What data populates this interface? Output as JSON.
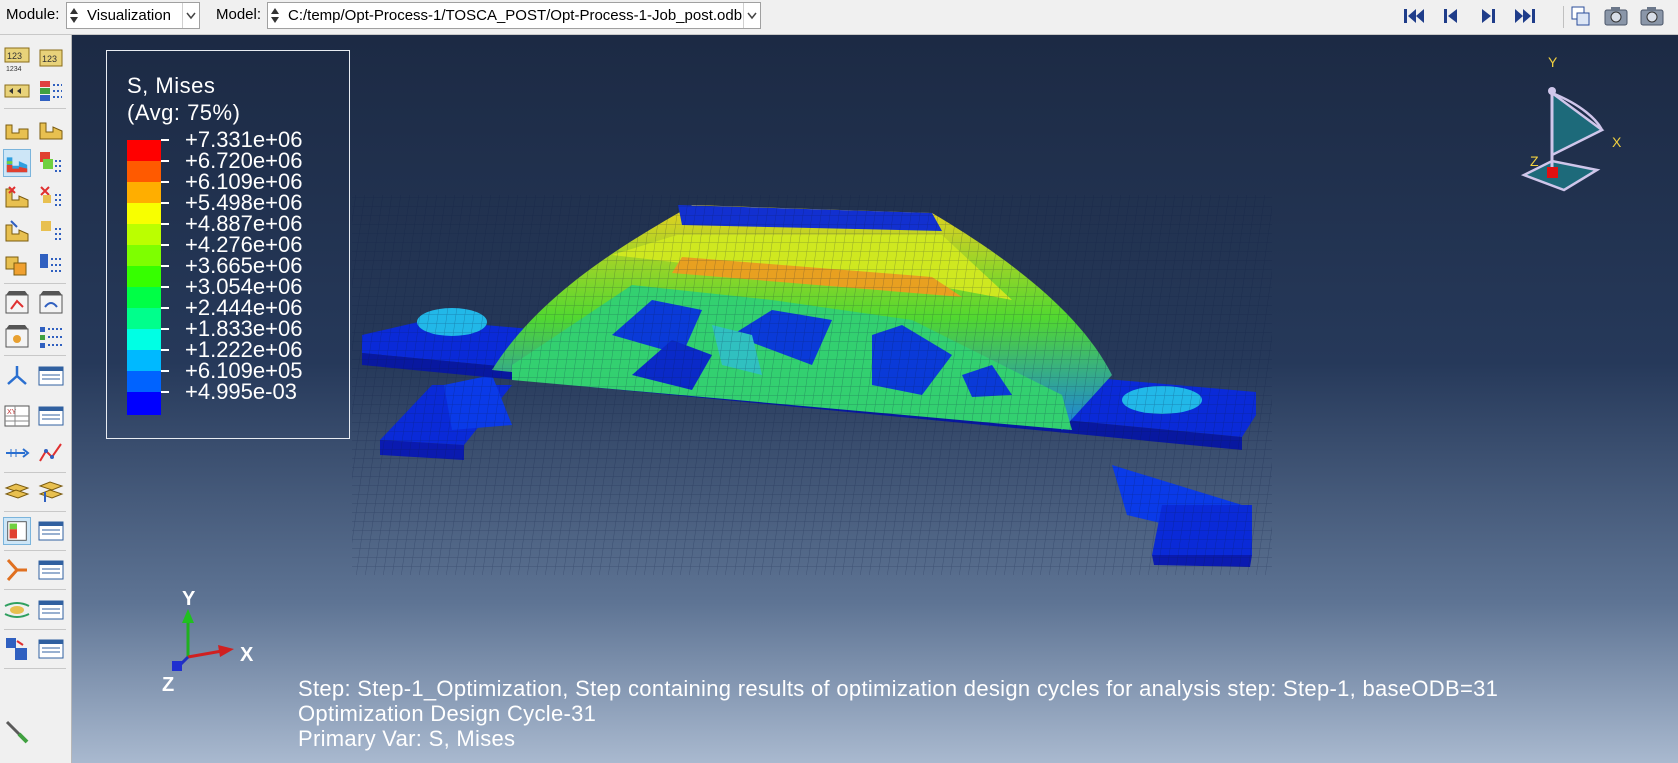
{
  "toolbar": {
    "module_label": "Module:",
    "module_value": "Visualization",
    "model_label": "Model:",
    "model_value": "C:/temp/Opt-Process-1/TOSCA_POST/Opt-Process-1-Job_post.odb",
    "icons": [
      "first-frame-icon",
      "previous-frame-icon",
      "next-frame-icon",
      "last-frame-icon",
      "copy-icon",
      "camera-icon",
      "camera-settings-icon"
    ]
  },
  "legend": {
    "title": "S, Mises",
    "subtitle": "(Avg: 75%)",
    "values": [
      "+7.331e+06",
      "+6.720e+06",
      "+6.109e+06",
      "+5.498e+06",
      "+4.887e+06",
      "+4.276e+06",
      "+3.665e+06",
      "+3.054e+06",
      "+2.444e+06",
      "+1.833e+06",
      "+1.222e+06",
      "+6.109e+05",
      "+4.995e-03"
    ],
    "colors": [
      "#ff0000",
      "#ff5a00",
      "#ffae00",
      "#f8ff00",
      "#bbff00",
      "#7eff00",
      "#36ff00",
      "#00ff46",
      "#00ff8c",
      "#00ffe4",
      "#00b9ff",
      "#0063ff",
      "#0000ff"
    ]
  },
  "info": {
    "step": "Step: Step-1_Optimization, Step containing results of optimization design cycles for analysis step: Step-1, baseODB=31",
    "cycle": "Optimization Design Cycle-31",
    "primary_var": "Primary Var: S, Mises"
  },
  "triad": {
    "x": "X",
    "y": "Y",
    "z": "Z"
  },
  "view_cube": {
    "x": "X",
    "y": "Y",
    "z": "Z"
  },
  "viewport": {
    "background_top": "#1c2a44",
    "background_bottom": "#a9b9cf"
  }
}
